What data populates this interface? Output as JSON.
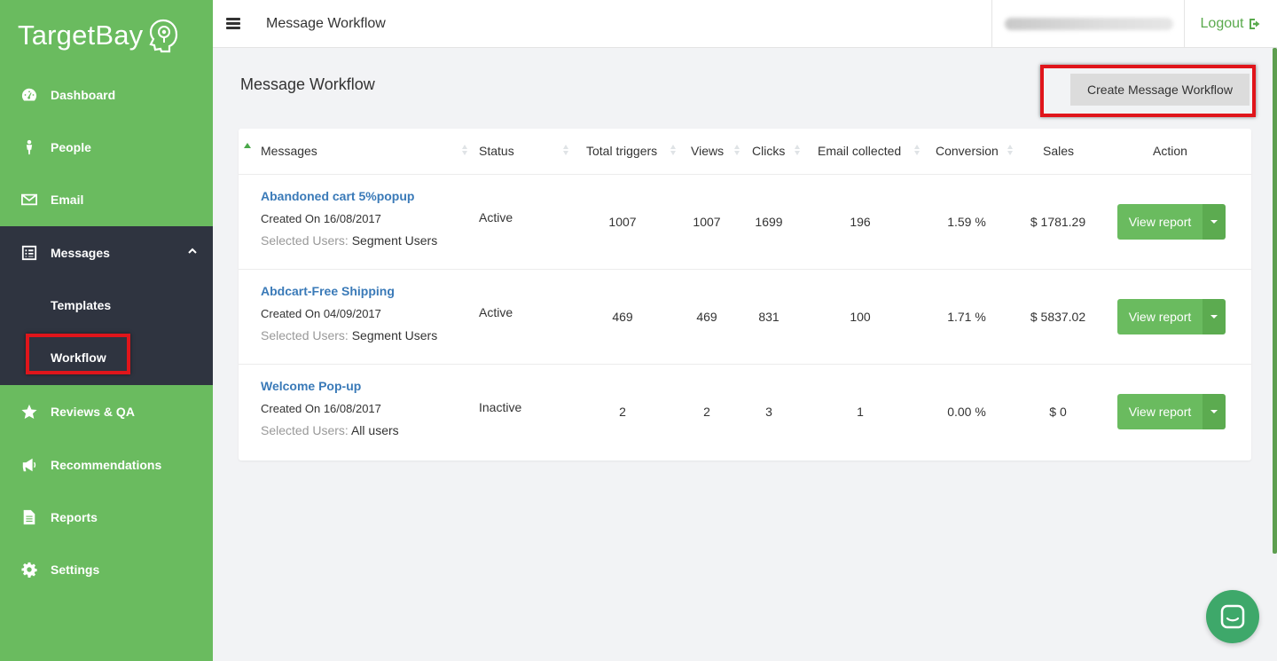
{
  "app": {
    "logo_text": "TargetBay",
    "brand_color": "#6abb5f",
    "sidebar_dark": "#2f3440"
  },
  "sidebar": {
    "items": [
      {
        "label": "Dashboard",
        "icon": "dashboard-gauge-icon"
      },
      {
        "label": "People",
        "icon": "person-icon"
      },
      {
        "label": "Email",
        "icon": "envelope-icon"
      },
      {
        "label": "Messages",
        "icon": "messages-list-icon"
      },
      {
        "label": "Reviews & QA",
        "icon": "star-icon"
      },
      {
        "label": "Recommendations",
        "icon": "megaphone-icon"
      },
      {
        "label": "Reports",
        "icon": "file-icon"
      },
      {
        "label": "Settings",
        "icon": "gear-icon"
      }
    ],
    "submenu": [
      {
        "label": "Templates"
      },
      {
        "label": "Workflow"
      }
    ]
  },
  "topbar": {
    "title": "Message Workflow",
    "logout_label": "Logout"
  },
  "main": {
    "heading": "Message Workflow",
    "create_button": "Create Message Workflow",
    "columns": [
      "Messages",
      "Status",
      "Total triggers",
      "Views",
      "Clicks",
      "Email collected",
      "Conversion",
      "Sales",
      "Action"
    ],
    "rows": [
      {
        "name": "Abandoned cart 5%popup",
        "created": "Created On 16/08/2017",
        "users_label": "Selected Users:",
        "users_value": "Segment Users",
        "status": "Active",
        "total_triggers": "1007",
        "views": "1007",
        "clicks": "1699",
        "email_collected": "196",
        "conversion": "1.59 %",
        "sales": "$ 1781.29",
        "action": "View report"
      },
      {
        "name": "Abdcart-Free Shipping",
        "created": "Created On 04/09/2017",
        "users_label": "Selected Users:",
        "users_value": "Segment Users",
        "status": "Active",
        "total_triggers": "469",
        "views": "469",
        "clicks": "831",
        "email_collected": "100",
        "conversion": "1.71 %",
        "sales": "$ 5837.02",
        "action": "View report"
      },
      {
        "name": "Welcome Pop-up",
        "created": "Created On 16/08/2017",
        "users_label": "Selected Users:",
        "users_value": "All users",
        "status": "Inactive",
        "total_triggers": "2",
        "views": "2",
        "clicks": "3",
        "email_collected": "1",
        "conversion": "0.00 %",
        "sales": "$ 0",
        "action": "View report"
      }
    ]
  }
}
